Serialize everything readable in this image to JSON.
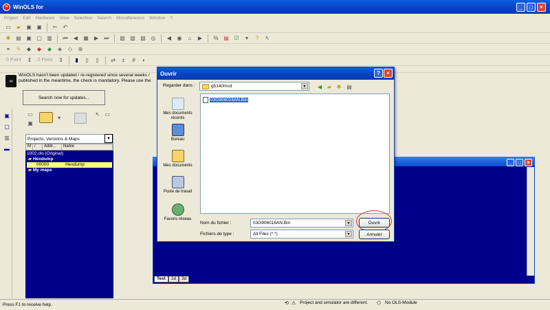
{
  "app": {
    "title": "WinOLS for",
    "menu": [
      "Project",
      "Edit",
      "Hardware",
      "View",
      "Selection",
      "Search",
      "Miscellaneous",
      "Window",
      "?"
    ],
    "point_buttons": [
      "0 Point",
      "0 Point"
    ],
    "notice_text": "WinOLS hasn't been updated / re-registered since several weeks / published in the meantime, the check is mandatory. Please use the",
    "search_updates_label": "Search now for updates...",
    "navigator_select": "Projects, Versions & Maps",
    "tree_columns": [
      "M",
      "/",
      "Addr...",
      "Name"
    ],
    "tree_rows": [
      {
        "text": "1002.ols (Original)",
        "indent": 0,
        "selected": false
      },
      {
        "text": "Hexdump",
        "indent": 1,
        "selected": false
      },
      {
        "text": "00000",
        "name": "Hexdump",
        "indent": 2,
        "selected": true
      },
      {
        "text": "My maps",
        "indent": 1,
        "selected": false
      }
    ],
    "tabs": [
      "Text",
      "2d",
      "3d"
    ],
    "status": {
      "help": "Press F1 to receive help.",
      "project": "Project and simulator are different.",
      "module": "No OLS-Module"
    }
  },
  "dialog": {
    "title": "Ouvrir",
    "lookin_label": "Regarder dans :",
    "lookin_value": "g5140mcd",
    "places": [
      "Mes documents récents",
      "Bureau",
      "Mes documents",
      "Poste de travail",
      "Favoris réseau"
    ],
    "files": [
      "03G906016AN.Bin"
    ],
    "filename_label": "Nom du fichier :",
    "filename_value": "03G906016AN.Bin",
    "filetype_label": "Fichiers de type :",
    "filetype_value": "All Files (*.*)",
    "open_button": "Ouvrir",
    "cancel_button": "Annuler"
  }
}
